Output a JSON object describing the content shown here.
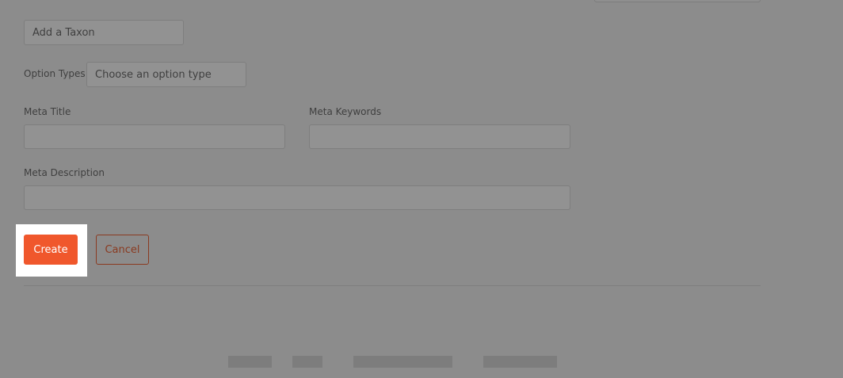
{
  "taxons": {
    "placeholder": "Add a Taxon"
  },
  "option_types": {
    "label": "Option Types",
    "placeholder": "Choose an option type"
  },
  "meta_title": {
    "label": "Meta Title",
    "value": ""
  },
  "meta_keywords": {
    "label": "Meta Keywords",
    "value": ""
  },
  "meta_description": {
    "label": "Meta Description",
    "value": ""
  },
  "actions": {
    "create_label": "Create",
    "cancel_label": "Cancel"
  },
  "colors": {
    "accent": "#f0572c",
    "overlay": "#8c8c8c"
  }
}
